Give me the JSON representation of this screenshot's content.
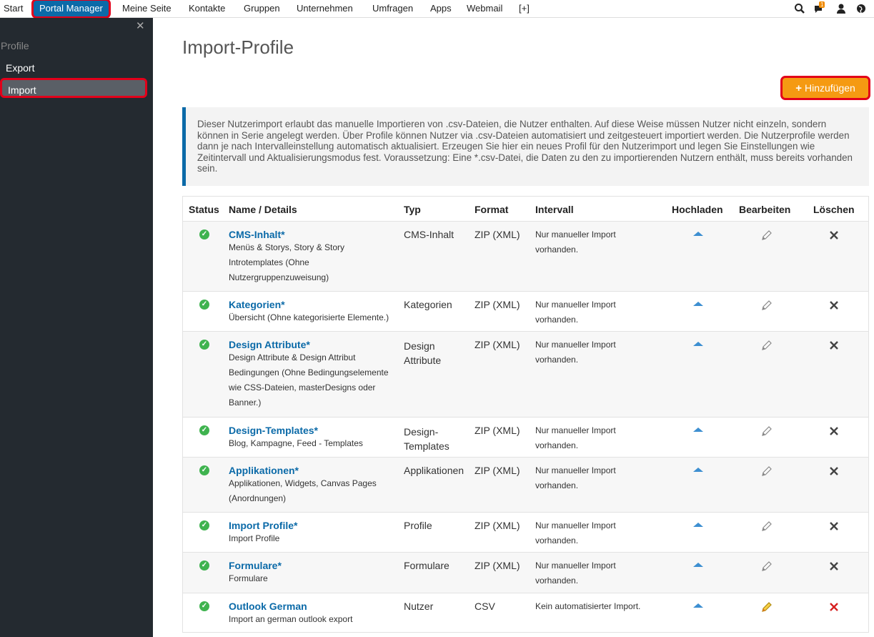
{
  "topnav": {
    "items": [
      "Start",
      "Portal Manager",
      "Meine Seite",
      "Kontakte",
      "Gruppen",
      "Unternehmen",
      "Umfragen",
      "Apps",
      "Webmail",
      "[+]"
    ],
    "notification_count": "1"
  },
  "sidebar": {
    "close": "✕",
    "heading": "Profile",
    "links": [
      "Export",
      "Import"
    ]
  },
  "main": {
    "title": "Import-Profile",
    "add_button": "Hinzufügen",
    "info": "Dieser Nutzerimport erlaubt das manuelle Importieren von .csv-Dateien, die Nutzer enthalten. Auf diese Weise müssen Nutzer nicht einzeln, sondern können in Serie angelegt werden. Über Profile können Nutzer via .csv-Dateien automatisiert und zeitgesteuert importiert werden. Die Nutzerprofile werden dann je nach Intervalleinstellung automatisch aktualisiert. Erzeugen Sie hier ein neues Profil für den Nutzerimport und legen Sie Einstellungen wie Zeitintervall und Aktualisierungsmodus fest. Voraussetzung: Eine *.csv-Datei, die Daten zu den zu importierenden Nutzern enthält, muss bereits vorhanden sein."
  },
  "table": {
    "headers": {
      "status": "Status",
      "name": "Name / Details",
      "typ": "Typ",
      "format": "Format",
      "intervall": "Intervall",
      "hochladen": "Hochladen",
      "bearbeiten": "Bearbeiten",
      "loeschen": "Löschen"
    },
    "rows": [
      {
        "name": "CMS-Inhalt*",
        "details": "Menüs & Storys, Story & Story Introtemplates (Ohne Nutzergruppenzuweisung)",
        "typ": "CMS-Inhalt",
        "format": "ZIP (XML)",
        "intervall": "Nur manueller Import vorhanden."
      },
      {
        "name": "Kategorien*",
        "details": "Übersicht (Ohne kategorisierte Elemente.)",
        "typ": "Kategorien",
        "format": "ZIP (XML)",
        "intervall": "Nur manueller Import vorhanden."
      },
      {
        "name": "Design Attribute*",
        "details": "Design Attribute & Design Attribut Bedingungen (Ohne Bedingungselemente wie CSS-Dateien, masterDesigns oder Banner.)",
        "typ": "Design Attribute",
        "format": "ZIP (XML)",
        "intervall": "Nur manueller Import vorhanden."
      },
      {
        "name": "Design-Templates*",
        "details": "Blog, Kampagne, Feed - Templates",
        "typ": "Design-Templates",
        "format": "ZIP (XML)",
        "intervall": "Nur manueller Import vorhanden."
      },
      {
        "name": "Applikationen*",
        "details": "Applikationen, Widgets, Canvas Pages (Anordnungen)",
        "typ": "Applikationen",
        "format": "ZIP (XML)",
        "intervall": "Nur manueller Import vorhanden."
      },
      {
        "name": "Import Profile*",
        "details": "Import Profile",
        "typ": "Profile",
        "format": "ZIP (XML)",
        "intervall": "Nur manueller Import vorhanden."
      },
      {
        "name": "Formulare*",
        "details": "Formulare",
        "typ": "Formulare",
        "format": "ZIP (XML)",
        "intervall": "Nur manueller Import vorhanden."
      },
      {
        "name": "Outlook German",
        "details": "Import an german outlook export",
        "typ": "Nutzer",
        "format": "CSV",
        "intervall": "Kein automatisierter Import."
      }
    ]
  },
  "colors": {
    "accent_blue": "#0b6aa8",
    "highlight_red": "#e2001a",
    "add_orange": "#f59a12",
    "status_green": "#3fb34f",
    "sidebar_bg": "#242a30"
  },
  "icons": {
    "search": "search-icon",
    "chat": "chat-icon",
    "user": "user-icon",
    "globe": "globe-icon",
    "status": "check-circle-icon",
    "upload": "upload-icon",
    "edit": "pencil-icon",
    "delete": "close-icon"
  }
}
